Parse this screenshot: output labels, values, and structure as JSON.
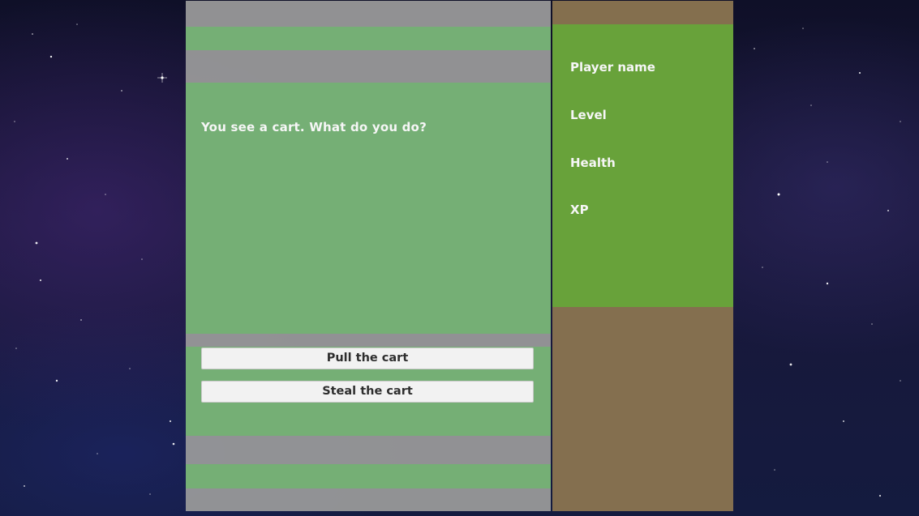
{
  "story": {
    "text": "You see a cart. What do you do?",
    "choices": [
      {
        "label": "Pull the cart"
      },
      {
        "label": "Steal the cart"
      }
    ]
  },
  "player": {
    "stats": [
      {
        "label": "Player name"
      },
      {
        "label": "Level"
      },
      {
        "label": "Health"
      },
      {
        "label": "XP"
      }
    ]
  },
  "colors": {
    "story_green": "#74b074",
    "panel_gray": "#9b9b9b",
    "stats_green": "#68a23a",
    "stats_brown": "#88734f",
    "button_bg": "#f2f2f2"
  }
}
